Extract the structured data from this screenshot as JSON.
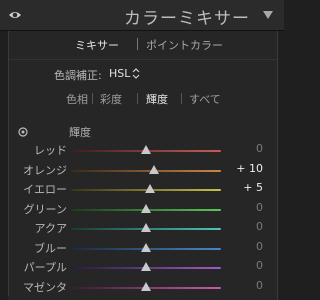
{
  "header": {
    "title": "カラーミキサー",
    "visibility_icon": "eye-icon",
    "collapse_icon": "triangle-down-icon"
  },
  "tabs": {
    "mixer": "ミキサー",
    "separator": "|",
    "point_color": "ポイントカラー"
  },
  "adjust": {
    "label": "色調補正:",
    "value": "HSL"
  },
  "subtabs": {
    "hue": "色相",
    "saturation": "彩度",
    "luminance": "輝度",
    "all": "すべて",
    "active": "luminance"
  },
  "section": {
    "label": "輝度",
    "target_icon": "target-adjust-icon"
  },
  "sliders": [
    {
      "label": "レッド",
      "value": "0",
      "level": 0.5
    },
    {
      "label": "オレンジ",
      "value": "+ 10",
      "level": 0.55
    },
    {
      "label": "イエロー",
      "value": "+ 5",
      "level": 0.525
    },
    {
      "label": "グリーン",
      "value": "0",
      "level": 0.5
    },
    {
      "label": "アクア",
      "value": "0",
      "level": 0.5
    },
    {
      "label": "ブルー",
      "value": "0",
      "level": 0.5
    },
    {
      "label": "パープル",
      "value": "0",
      "level": 0.5
    },
    {
      "label": "マゼンタ",
      "value": "0",
      "level": 0.5
    }
  ],
  "colors": {
    "red": [
      "#3a1f1f",
      "#c85a5a"
    ],
    "orange": [
      "#3a2a1a",
      "#c8864a"
    ],
    "yellow": [
      "#38351a",
      "#c8c04a"
    ],
    "green": [
      "#1d3a1d",
      "#5ac85a"
    ],
    "aqua": [
      "#1a3a36",
      "#4ac8b8"
    ],
    "blue": [
      "#1a2a3a",
      "#4a86c8"
    ],
    "purple": [
      "#2a1a3a",
      "#a05ac8"
    ],
    "magenta": [
      "#3a1a30",
      "#c85aaa"
    ]
  }
}
